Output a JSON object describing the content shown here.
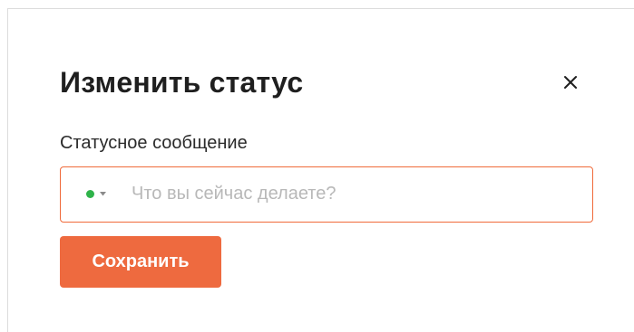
{
  "dialog": {
    "title": "Изменить статус",
    "close_icon": "close-icon",
    "field_label": "Статусное сообщение",
    "status": {
      "indicator_color": "#2fb34a",
      "dropdown_icon": "chevron-down-icon"
    },
    "input": {
      "value": "",
      "placeholder": "Что вы сейчас делаете?"
    },
    "save_label": "Сохранить"
  },
  "colors": {
    "accent": "#ee6a3f",
    "input_border": "#f06a3a",
    "title_text": "#1f1f1f"
  }
}
